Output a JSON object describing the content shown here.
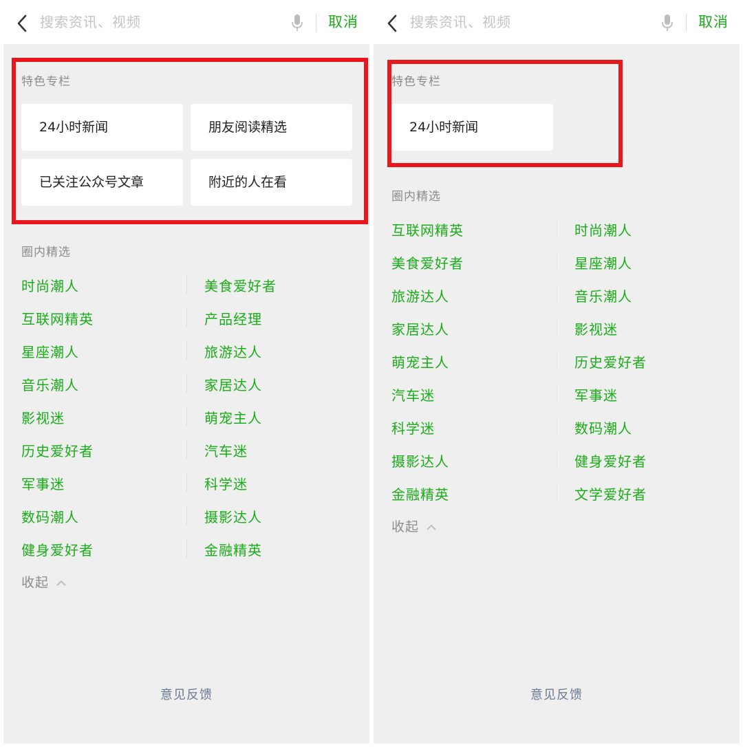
{
  "colors": {
    "accent": "#1aad19",
    "highlight": "#e9171c",
    "background": "#efefef"
  },
  "left": {
    "header": {
      "search_placeholder": "搜索资讯、视频",
      "cancel": "取消"
    },
    "featured_title": "特色专栏",
    "featured": [
      "24小时新闻",
      "朋友阅读精选",
      "已关注公众号文章",
      "附近的人在看"
    ],
    "circle_title": "圈内精选",
    "tags_left": [
      "时尚潮人",
      "互联网精英",
      "星座潮人",
      "音乐潮人",
      "影视迷",
      "历史爱好者",
      "军事迷",
      "数码潮人",
      "健身爱好者"
    ],
    "tags_right": [
      "美食爱好者",
      "产品经理",
      "旅游达人",
      "家居达人",
      "萌宠主人",
      "汽车迷",
      "科学迷",
      "摄影达人",
      "金融精英"
    ],
    "collapse": "收起",
    "feedback": "意见反馈"
  },
  "right": {
    "header": {
      "search_placeholder": "搜索资讯、视频",
      "cancel": "取消"
    },
    "featured_title": "特色专栏",
    "featured": [
      "24小时新闻"
    ],
    "circle_title": "圈内精选",
    "tags_left": [
      "互联网精英",
      "美食爱好者",
      "旅游达人",
      "家居达人",
      "萌宠主人",
      "汽车迷",
      "科学迷",
      "摄影达人",
      "金融精英"
    ],
    "tags_right": [
      "时尚潮人",
      "星座潮人",
      "音乐潮人",
      "影视迷",
      "历史爱好者",
      "军事迷",
      "数码潮人",
      "健身爱好者",
      "文学爱好者"
    ],
    "collapse": "收起",
    "feedback": "意见反馈"
  }
}
